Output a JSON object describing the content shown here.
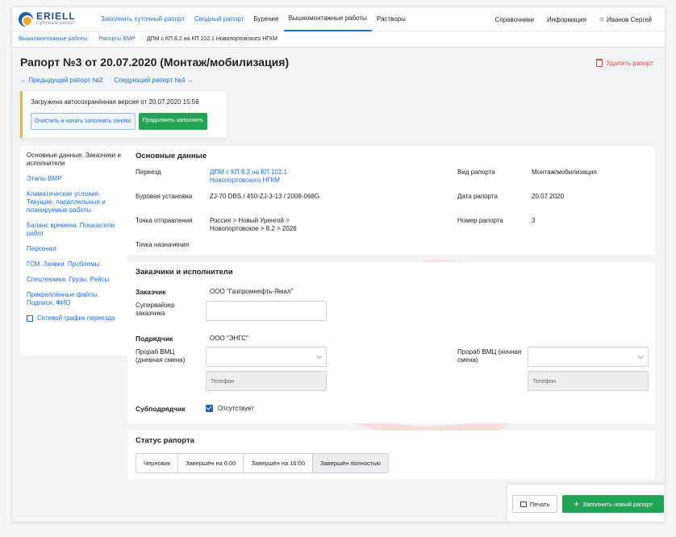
{
  "app": {
    "logo_name": "ERIELL",
    "logo_sub": "Суточный рапорт",
    "brand_color": "#1f4e8c",
    "accent": "#1d6fd6",
    "success": "#23a455",
    "danger": "#e04a3f"
  },
  "nav": {
    "items": [
      "Заполнить суточный рапорт",
      "Сводный рапорт",
      "Бурение",
      "Вышкомонтажные работы",
      "Растворы"
    ],
    "right": [
      "Справочники",
      "Информация"
    ],
    "user": "Иванов Сергей"
  },
  "breadcrumb": [
    "Вышкомонтажные работы",
    "Рапорты ВМР",
    "ДПМ с КП 8.2 на КП 102.1 Новопортовского НГКМ"
  ],
  "page": {
    "title": "Рапорт №3 от 20.07.2020 (Монтаж/мобилизация)",
    "delete": "Удалить рапорт",
    "prev": "← Предыдущий рапорт №2",
    "next": "Следующий рапорт №4 →"
  },
  "notice": {
    "text": "Загружена автосохранённая версия от 20.07.2020 15:56",
    "clear": "Очистить и начать заполнять заново",
    "continue": "Продолжить заполнять"
  },
  "sidebar": [
    "Основные данные. Заказчики и исполнители",
    "Этапы ВМР",
    "Климатические условия. Текущие, параллельные и планируемые работы",
    "Баланс времени. Показатели работ",
    "Персонал",
    "ГСМ. Заявки. Проблемы",
    "Спецтехника. Грузы. Рейсы",
    "Прикреплённые файлы. Подписи, ФИО",
    "Сетевой график переезда"
  ],
  "basic": {
    "title": "Основные данные",
    "move_label": "Переезд",
    "move_value": "ДПМ с КП 8.2 на КП 102.1 Новопортовского НГКМ",
    "rig_label": "Буровая установка",
    "rig_value": "ZJ-70 DBS / 450-ZJ-3-13 / 2008-068G",
    "from_label": "Точка отправления",
    "from_value": "Россия > Новый Уренгой > Новопортовское > 8.2 > 2026",
    "to_label": "Точка назначения",
    "type_label": "Вид рапорта",
    "type_value": "Монтаж/мобилизация",
    "date_label": "Дата рапорта",
    "date_value": "20.07.2020",
    "num_label": "Номер рапорта",
    "num_value": "3"
  },
  "parties": {
    "title": "Заказчики и исполнители",
    "customer_label": "Заказчик",
    "customer_value": "ООО \"Газпромнефть-Ямал\"",
    "supervisor_label": "Супервайзер заказчика",
    "contractor_label": "Подрядчик",
    "contractor_value": "ООО \"ЭНГС\"",
    "foreman_day_label": "Прораб ВМЦ (дневная смена)",
    "foreman_night_label": "Прораб ВМЦ (ночная смена)",
    "phone_placeholder": "Телефон",
    "sub_label": "Субподрядчик",
    "sub_check": "Отсутствует"
  },
  "status": {
    "title": "Статус рапорта",
    "options": [
      "Черновик",
      "Завершён на 6:00",
      "Завершён на 16:00",
      "Завершён полностью"
    ],
    "selected": "Завершён полностью"
  },
  "actions": {
    "print": "Печать",
    "new": "Заполнить новый рапорт"
  }
}
